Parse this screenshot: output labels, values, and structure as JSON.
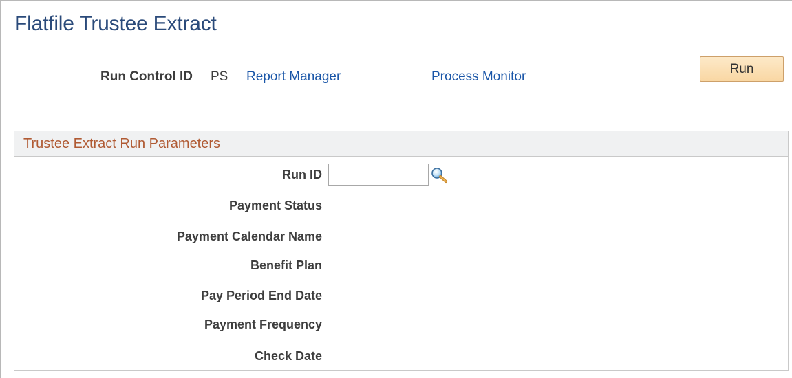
{
  "page": {
    "title": "Flatfile Trustee Extract"
  },
  "run_control": {
    "label": "Run Control ID",
    "value": "PS",
    "report_manager_link": "Report Manager",
    "process_monitor_link": "Process Monitor",
    "run_button": "Run"
  },
  "parameters": {
    "title": "Trustee Extract Run Parameters",
    "run_id_label": "Run ID",
    "run_id_value": "",
    "payment_status_label": "Payment Status",
    "payment_calendar_name_label": "Payment Calendar Name",
    "benefit_plan_label": "Benefit Plan",
    "pay_period_end_date_label": "Pay Period End Date",
    "payment_frequency_label": "Payment Frequency",
    "check_date_label": "Check Date"
  },
  "icons": {
    "lookup": "magnifying-glass-icon"
  },
  "colors": {
    "title": "#2a4a7a",
    "link": "#1a56a8",
    "group_title": "#b05a33",
    "run_button_bg": "#f9d7a3"
  }
}
